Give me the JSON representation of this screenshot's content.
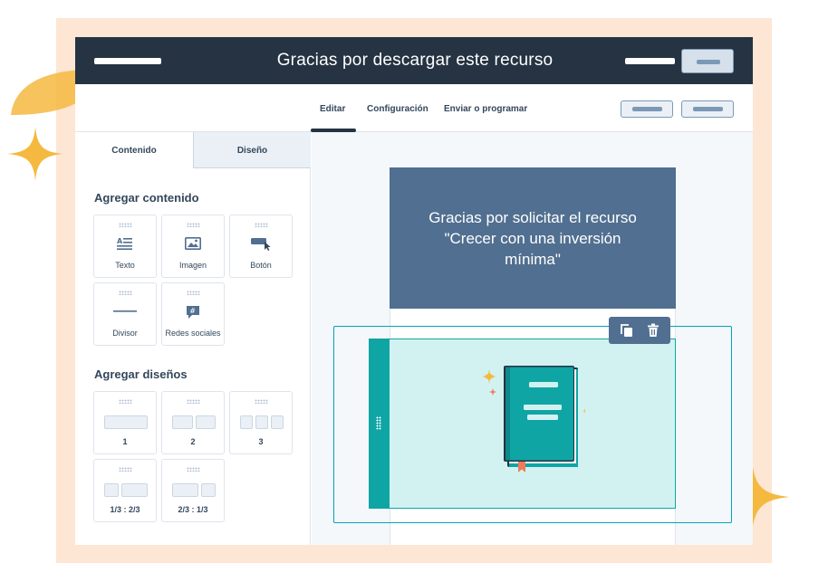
{
  "header": {
    "title": "Gracias por descargar este recurso"
  },
  "tabs": [
    {
      "label": "Editar",
      "active": true
    },
    {
      "label": "Configuración",
      "active": false
    },
    {
      "label": "Enviar o programar",
      "active": false
    }
  ],
  "sidebar": {
    "tabs": [
      {
        "label": "Contenido",
        "active": true
      },
      {
        "label": "Diseño",
        "active": false
      }
    ],
    "add_content": {
      "heading": "Agregar contenido",
      "items": [
        {
          "label": "Texto",
          "icon": "text-icon"
        },
        {
          "label": "Imagen",
          "icon": "image-icon"
        },
        {
          "label": "Botón",
          "icon": "button-icon"
        },
        {
          "label": "Divisor",
          "icon": "divider-icon"
        },
        {
          "label": "Redes sociales",
          "icon": "social-icon"
        }
      ]
    },
    "add_layouts": {
      "heading": "Agregar diseños",
      "items": [
        {
          "label": "1",
          "columns": 1
        },
        {
          "label": "2",
          "columns": 2
        },
        {
          "label": "3",
          "columns": 3
        },
        {
          "label": "1/3 : 2/3",
          "columns": 2
        },
        {
          "label": "2/3 : 1/3",
          "columns": 2
        }
      ]
    }
  },
  "email": {
    "hero_text": "Gracias por solicitar el recurso\n\"Crecer con una inversión\nmínima\""
  },
  "colors": {
    "header": "#253342",
    "hero": "#516f90",
    "accent_teal": "#0fa5a4",
    "selection_fill": "#d2f2f1",
    "frame": "#fde6d3",
    "sparkle": "#f5b93f"
  }
}
